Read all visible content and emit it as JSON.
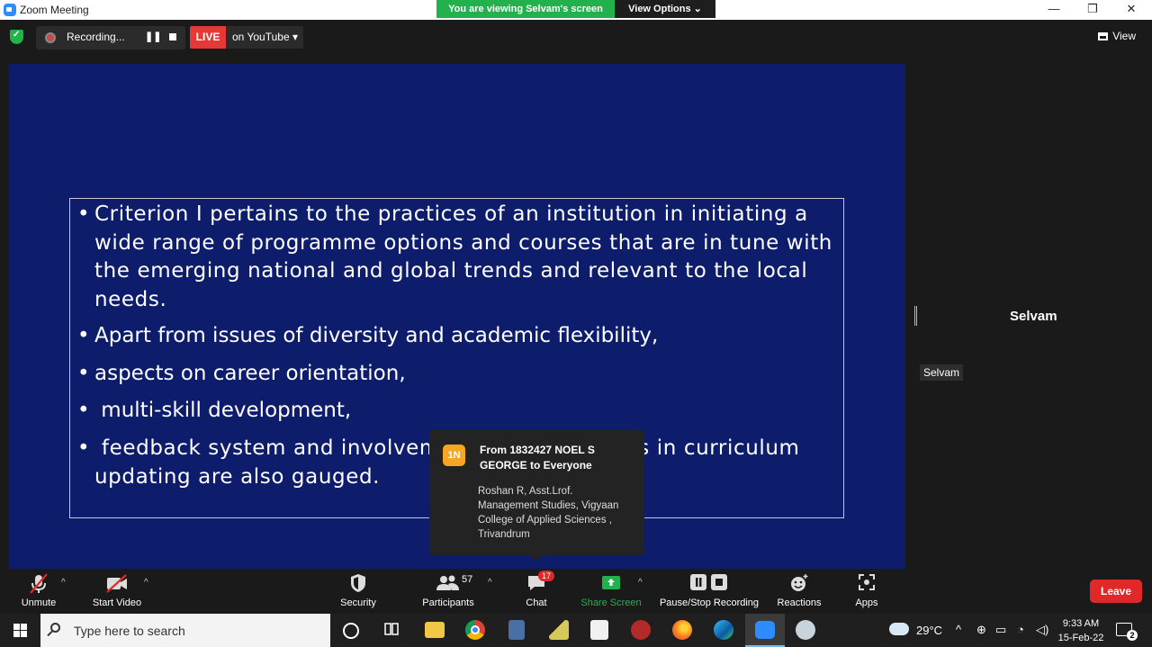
{
  "window": {
    "title": "Zoom Meeting",
    "viewing_banner": "You are viewing Selvam's screen",
    "view_options": "View Options ⌄",
    "minimize": "—",
    "restore": "❐",
    "close": "✕"
  },
  "topbar": {
    "recording_label": "Recording...",
    "pause_glyph": "❚❚",
    "live_label": "LIVE",
    "stream_target": "on YouTube ▾",
    "view_label": "View"
  },
  "slide": {
    "bullet_glyph": "•",
    "bullets": [
      "Criterion I pertains to the practices of an institution in initiating a wide range of programme options and courses that are in tune with the emerging national and global trends and relevant to the local needs.",
      "Apart from issues of diversity and academic flexibility,",
      "aspects on career orientation,",
      " multi-skill development,",
      " feedback system and involvement of stakeholders in curriculum updating are also gauged."
    ]
  },
  "chat_popup": {
    "avatar_initials": "1N",
    "from": "From 1832427 NOEL S GEORGE to Everyone",
    "message": "Roshan R, Asst.Lrof. Management Studies, Vigyaan College of Applied Sciences , Trivandrum"
  },
  "participant": {
    "name": "Selvam",
    "tag": "Selvam"
  },
  "toolbar": {
    "unmute": "Unmute",
    "start_video": "Start Video",
    "security": "Security",
    "participants": "Participants",
    "participants_count": "57",
    "chat": "Chat",
    "chat_badge": "17",
    "share_screen": "Share Screen",
    "pause_stop_recording": "Pause/Stop Recording",
    "reactions": "Reactions",
    "apps": "Apps",
    "leave": "Leave",
    "caret": "^"
  },
  "taskbar": {
    "search_placeholder": "Type here to search",
    "temperature": "29°C",
    "time": "9:33 AM",
    "date": "15-Feb-22",
    "notification_count": "2"
  },
  "colors": {
    "slide_background": "#0d1d6b",
    "banner_green": "#22b14c",
    "live_red": "#e53935",
    "leave_red": "#e02828"
  }
}
